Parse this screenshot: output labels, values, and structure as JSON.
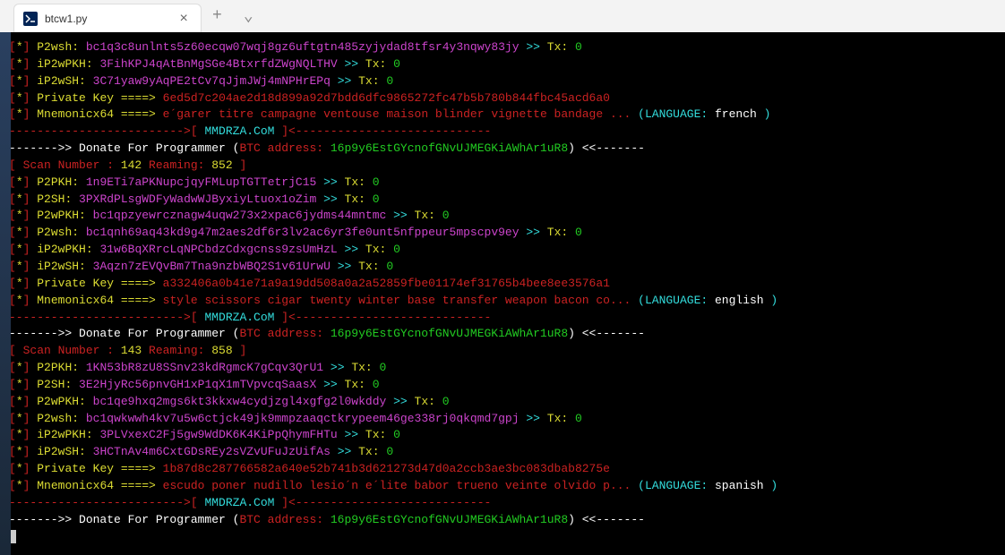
{
  "tab": {
    "title": "btcw1.py",
    "close": "×",
    "plus": "+",
    "chevron": "⌄"
  },
  "donate_prefix": "------->> Donate For Programmer (",
  "btc_label": "BTC address: ",
  "btc_addr": "16p9y6EstGYcnofGNvUJMEGKiAWhAr1uR8",
  "donate_suffix": ") <<-------",
  "site_line_left": "------------------------->[ ",
  "site_name": "MMDRZA.CoM",
  "site_line_right": " ]<----------------------------",
  "tx_label": " Tx: ",
  "tx_val": "0",
  "arrow": " >>",
  "pk_label": " Private Key ====> ",
  "mn_label": " Mnemonicx64 ====> ",
  "lang_label": "  (LANGUAGE: ",
  "blocks": [
    {
      "addrs": [
        {
          "label": " P2wsh: ",
          "val": "bc1q3c8unlnts5z60ecqw07wqj8gz6uftgtn485zyjydad8tfsr4y3nqwy83jy"
        },
        {
          "label": " iP2wPKH: ",
          "val": "3FihKPJ4qAtBnMgSGe4BtxrfdZWgNQLTHV"
        },
        {
          "label": " iP2wSH: ",
          "val": "3C71yaw9yAqPE2tCv7qJjmJWj4mNPHrEPq"
        }
      ],
      "pk": "6ed5d7c204ae2d18d899a92d7bdd6dfc9865272fc47b5b780b844fbc45acd6a0",
      "mnemonic": "e´garer titre campagne ventouse maison blinder vignette bandage ...",
      "language": "french "
    },
    {
      "scan": "142",
      "ream": "852",
      "addrs": [
        {
          "label": " P2PKH: ",
          "val": "1n9ETi7aPKNupcjqyFMLupTGTTetrjC15"
        },
        {
          "label": " P2SH: ",
          "val": "3PXRdPLsgWDFyWadwWJByxiyLtuox1oZim"
        },
        {
          "label": " P2wPKH: ",
          "val": "bc1qpzyewrcznagw4uqw273x2xpac6jydms44mntmc"
        },
        {
          "label": " P2wsh: ",
          "val": "bc1qnh69aq43kd9g47m2aes2df6r3lv2ac6yr3fe0unt5nfppeur5mpscpv9ey"
        },
        {
          "label": " iP2wPKH: ",
          "val": "31w6BqXRrcLqNPCbdzCdxgcnss9zsUmHzL"
        },
        {
          "label": " iP2wSH: ",
          "val": "3Aqzn7zEVQvBm7Tna9nzbWBQ2S1v61UrwU"
        }
      ],
      "pk": "a332406a0b41e71a9a19dd508a0a2a52859fbe01174ef31765b4bee8ee3576a1",
      "mnemonic": "style scissors cigar twenty winter base transfer weapon bacon co...",
      "language": "english "
    },
    {
      "scan": "143",
      "ream": "858",
      "addrs": [
        {
          "label": " P2PKH: ",
          "val": "1KN53bR8zU8SSnv23kdRgmcK7gCqv3QrU1"
        },
        {
          "label": " P2SH: ",
          "val": "3E2HjyRc56pnvGH1xP1qX1mTVpvcqSaasX"
        },
        {
          "label": " P2wPKH: ",
          "val": "bc1qe9hxq2mgs6kt3kkxw4cydjzgl4xgfg2l0wkddy"
        },
        {
          "label": " P2wsh: ",
          "val": "bc1qwkwwh4kv7u5w6ctjck49jk9mmpzaaqctkrypeem46ge338rj0qkqmd7gpj"
        },
        {
          "label": " iP2wPKH: ",
          "val": "3PLVxexC2Fj5gw9WdDK6K4KiPpQhymFHTu"
        },
        {
          "label": " iP2wSH: ",
          "val": "3HCTnAv4m6CxtGDsREy2sVZvUFuJzUifAs"
        }
      ],
      "pk": "1b87d8c287766582a640e52b741b3d621273d47d0a2ccb3ae3bc083dbab8275e",
      "mnemonic": "escudo poner nudillo lesio´n e´lite babor trueno veinte olvido p...",
      "language": "spanish "
    }
  ],
  "scan_prefix": "[ Scan Number : ",
  "scan_mid": "      Reaming: ",
  "scan_suffix": " ]"
}
